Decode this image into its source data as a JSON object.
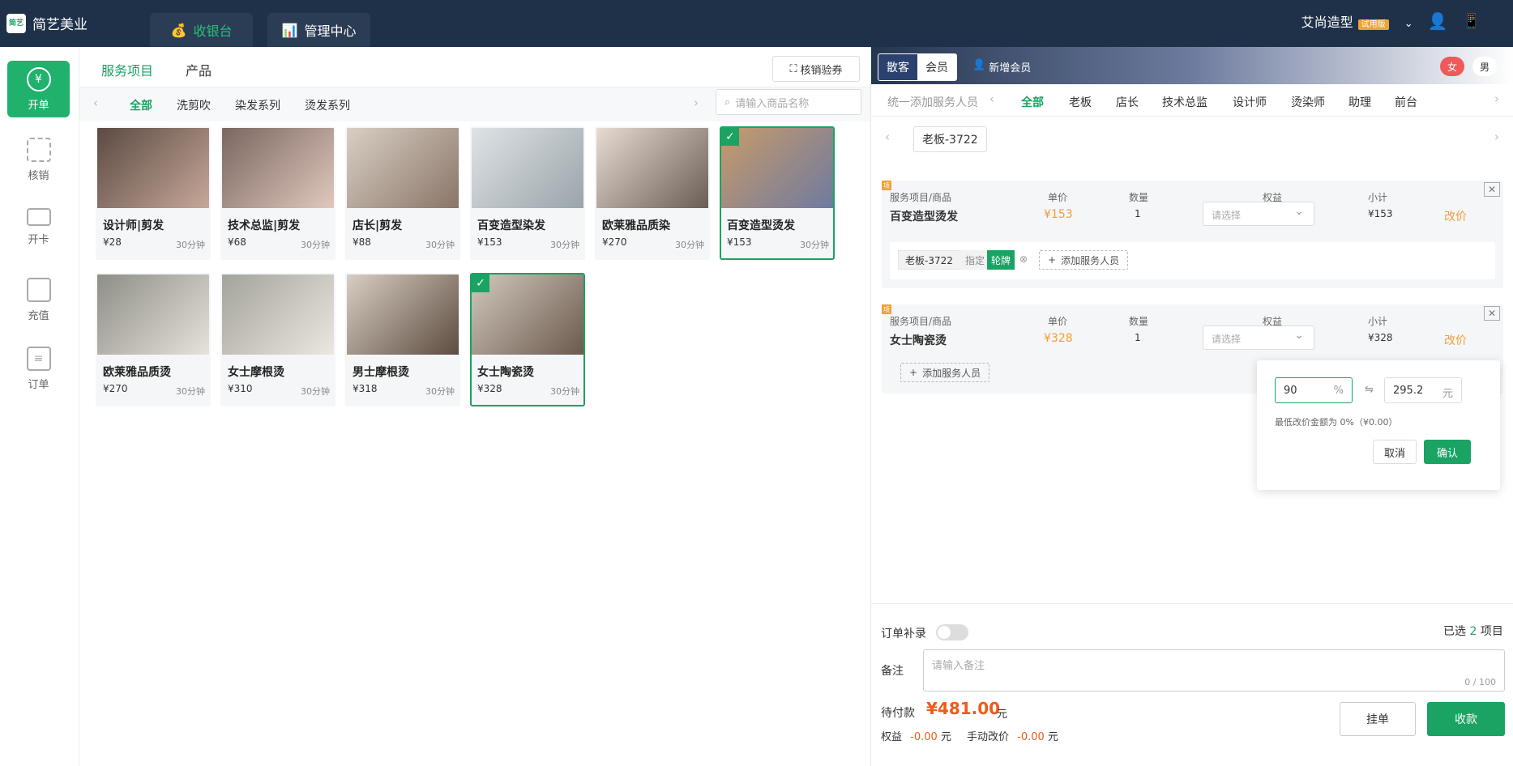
{
  "app": {
    "logo_mark": "简艺",
    "name": "简艺美业"
  },
  "topnav": [
    {
      "label": "收银台",
      "icon": "money-bag-icon"
    },
    {
      "label": "管理中心",
      "icon": "bar-chart-icon"
    }
  ],
  "store": {
    "name": "艾尚造型",
    "badge": "试用版"
  },
  "sidebar": [
    {
      "label": "开单",
      "icon": "yen-check-icon"
    },
    {
      "label": "核销",
      "icon": "scan-icon"
    },
    {
      "label": "开卡",
      "icon": "card-icon"
    },
    {
      "label": "充值",
      "icon": "wallet-icon"
    },
    {
      "label": "订单",
      "icon": "clipboard-icon"
    }
  ],
  "main": {
    "tabs": [
      "服务项目",
      "产品"
    ],
    "verify_label": "核销验券",
    "categories": [
      "全部",
      "洗剪吹",
      "染发系列",
      "烫发系列"
    ],
    "search_placeholder": "请输入商品名称",
    "products": [
      {
        "name": "设计师|剪发",
        "price": "¥28",
        "duration": "30分钟",
        "selected": false
      },
      {
        "name": "技术总监|剪发",
        "price": "¥68",
        "duration": "30分钟",
        "selected": false
      },
      {
        "name": "店长|剪发",
        "price": "¥88",
        "duration": "30分钟",
        "selected": false
      },
      {
        "name": "百变造型染发",
        "price": "¥153",
        "duration": "30分钟",
        "selected": false
      },
      {
        "name": "欧莱雅品质染",
        "price": "¥270",
        "duration": "30分钟",
        "selected": false
      },
      {
        "name": "百变造型烫发",
        "price": "¥153",
        "duration": "30分钟",
        "selected": true
      },
      {
        "name": "欧莱雅品质烫",
        "price": "¥270",
        "duration": "30分钟",
        "selected": false
      },
      {
        "name": "女士摩根烫",
        "price": "¥310",
        "duration": "30分钟",
        "selected": false
      },
      {
        "name": "男士摩根烫",
        "price": "¥318",
        "duration": "30分钟",
        "selected": false
      },
      {
        "name": "女士陶瓷烫",
        "price": "¥328",
        "duration": "30分钟",
        "selected": true
      }
    ]
  },
  "right": {
    "customer_types": [
      "散客",
      "会员"
    ],
    "add_member": "新增会员",
    "gender": {
      "female": "女",
      "male": "男"
    },
    "unify_label": "统一添加服务人员",
    "roles": [
      "全部",
      "老板",
      "店长",
      "技术总监",
      "设计师",
      "烫染师",
      "助理",
      "前台"
    ],
    "staff": "老板-3722",
    "headers": {
      "item": "服务项目/商品",
      "price": "单价",
      "qty": "数量",
      "benefit": "权益",
      "subtotal": "小计"
    },
    "orders": [
      {
        "badge": "项",
        "name": "百变造型烫发",
        "price": "¥153",
        "qty": "1",
        "benefit_placeholder": "请选择",
        "subtotal": "¥153",
        "edit": "改价",
        "staff_tag": "老板-3722",
        "assign_label": "指定",
        "rotation_label": "轮牌",
        "add_staff": "添加服务人员"
      },
      {
        "badge": "项",
        "name": "女士陶瓷烫",
        "price": "¥328",
        "qty": "1",
        "benefit_placeholder": "请选择",
        "subtotal": "¥328",
        "edit": "改价",
        "add_staff": "添加服务人员"
      }
    ],
    "price_edit": {
      "percent": "90",
      "percent_unit": "%",
      "equiv": "⇋",
      "amount": "295.2",
      "amount_unit": "元",
      "hint": "最低改价金额为 0%（¥0.00）",
      "cancel": "取消",
      "confirm": "确认"
    },
    "footer": {
      "supplement_label": "订单补录",
      "selected_prefix": "已选",
      "selected_count": "2",
      "selected_suffix": "项目",
      "note_label": "备注",
      "note_placeholder": "请输入备注",
      "note_count": "0 / 100",
      "due_label": "待付款",
      "due_amount": "¥481.00",
      "due_unit": "元",
      "benefit_label": "权益",
      "benefit_value": "-0.00",
      "benefit_unit": "元",
      "manual_label": "手动改价",
      "manual_value": "-0.00",
      "manual_unit": "元",
      "hold": "挂单",
      "checkout": "收款"
    }
  }
}
